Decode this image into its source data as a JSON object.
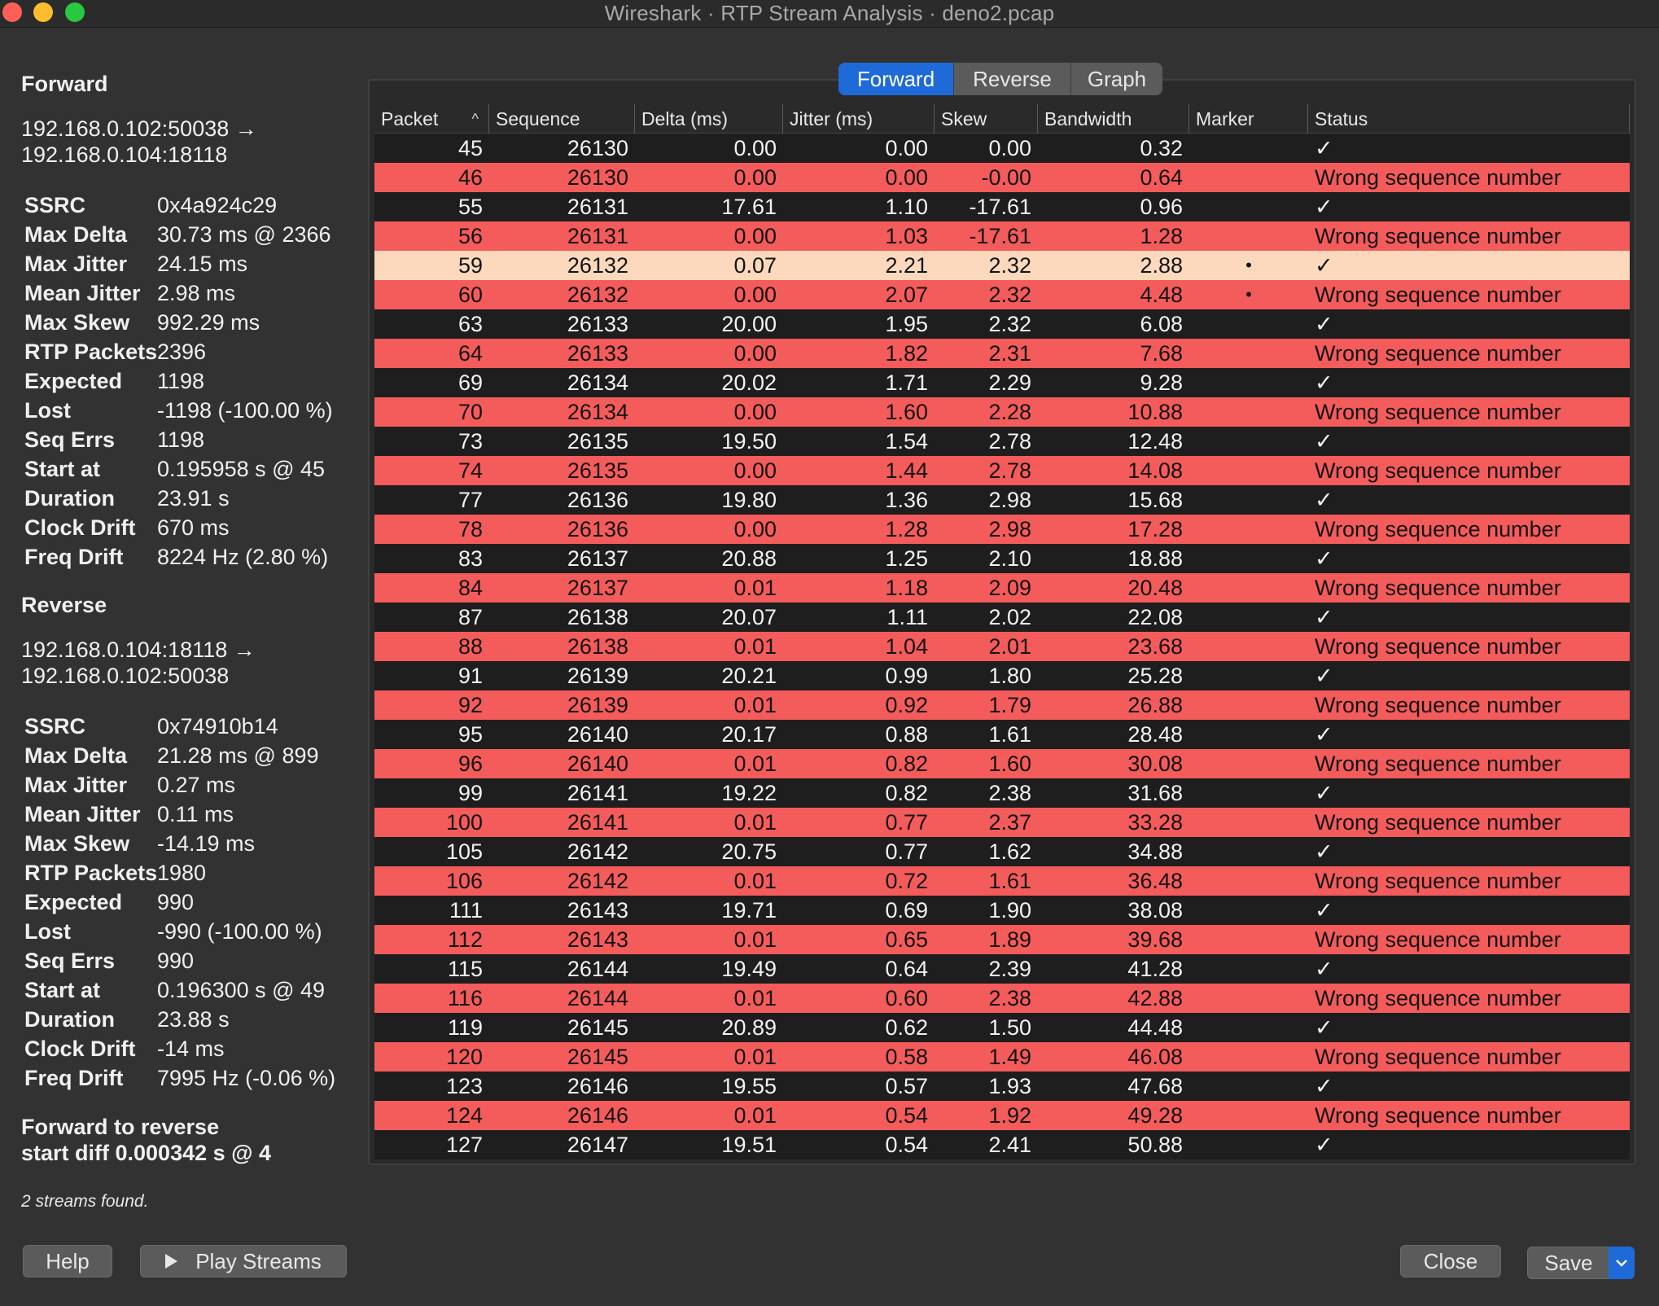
{
  "window": {
    "title": "Wireshark · RTP Stream Analysis · deno2.pcap"
  },
  "forward": {
    "title": "Forward",
    "address_line1": "192.168.0.102:50038 →",
    "address_line2": "192.168.0.104:18118",
    "stats": [
      {
        "key": "SSRC",
        "value": "0x4a924c29"
      },
      {
        "key": "Max Delta",
        "value": "30.73 ms @ 2366"
      },
      {
        "key": "Max Jitter",
        "value": "24.15 ms"
      },
      {
        "key": "Mean Jitter",
        "value": "2.98 ms"
      },
      {
        "key": "Max Skew",
        "value": "992.29 ms"
      },
      {
        "key": "RTP Packets",
        "value": "2396"
      },
      {
        "key": "Expected",
        "value": "1198"
      },
      {
        "key": "Lost",
        "value": "-1198 (-100.00 %)"
      },
      {
        "key": "Seq Errs",
        "value": "1198"
      },
      {
        "key": "Start at",
        "value": "0.195958 s @ 45"
      },
      {
        "key": "Duration",
        "value": "23.91 s"
      },
      {
        "key": "Clock Drift",
        "value": "670 ms"
      },
      {
        "key": "Freq Drift",
        "value": "8224 Hz (2.80 %)"
      }
    ]
  },
  "reverse": {
    "title": "Reverse",
    "address_line1": "192.168.0.104:18118 →",
    "address_line2": "192.168.0.102:50038",
    "stats": [
      {
        "key": "SSRC",
        "value": "0x74910b14"
      },
      {
        "key": "Max Delta",
        "value": "21.28 ms @ 899"
      },
      {
        "key": "Max Jitter",
        "value": "0.27 ms"
      },
      {
        "key": "Mean Jitter",
        "value": "0.11 ms"
      },
      {
        "key": "Max Skew",
        "value": "-14.19 ms"
      },
      {
        "key": "RTP Packets",
        "value": "1980"
      },
      {
        "key": "Expected",
        "value": "990"
      },
      {
        "key": "Lost",
        "value": "-990 (-100.00 %)"
      },
      {
        "key": "Seq Errs",
        "value": "990"
      },
      {
        "key": "Start at",
        "value": "0.196300 s @ 49"
      },
      {
        "key": "Duration",
        "value": "23.88 s"
      },
      {
        "key": "Clock Drift",
        "value": "-14 ms"
      },
      {
        "key": "Freq Drift",
        "value": "7995 Hz (-0.06 %)"
      }
    ]
  },
  "summary": {
    "start_diff_line1": "Forward to reverse",
    "start_diff_line2": "start diff 0.000342 s @ 4",
    "streams_found": "2 streams found."
  },
  "tabs": [
    {
      "label": "Forward",
      "active": true
    },
    {
      "label": "Reverse",
      "active": false
    },
    {
      "label": "Graph",
      "active": false
    }
  ],
  "table": {
    "columns": [
      "Packet",
      "Sequence",
      "Delta (ms)",
      "Jitter (ms)",
      "Skew",
      "Bandwidth",
      "Marker",
      "Status"
    ],
    "sort_indicator": "^",
    "rows": [
      {
        "packet": "45",
        "sequence": "26130",
        "delta": "0.00",
        "jitter": "0.00",
        "skew": "0.00",
        "bandwidth": "0.32",
        "marker": "",
        "status": "✓",
        "state": "ok"
      },
      {
        "packet": "46",
        "sequence": "26130",
        "delta": "0.00",
        "jitter": "0.00",
        "skew": "-0.00",
        "bandwidth": "0.64",
        "marker": "",
        "status": "Wrong sequence number",
        "state": "err"
      },
      {
        "packet": "55",
        "sequence": "26131",
        "delta": "17.61",
        "jitter": "1.10",
        "skew": "-17.61",
        "bandwidth": "0.96",
        "marker": "",
        "status": "✓",
        "state": "ok"
      },
      {
        "packet": "56",
        "sequence": "26131",
        "delta": "0.00",
        "jitter": "1.03",
        "skew": "-17.61",
        "bandwidth": "1.28",
        "marker": "",
        "status": "Wrong sequence number",
        "state": "err"
      },
      {
        "packet": "59",
        "sequence": "26132",
        "delta": "0.07",
        "jitter": "2.21",
        "skew": "2.32",
        "bandwidth": "2.88",
        "marker": "•",
        "status": "✓",
        "state": "sel"
      },
      {
        "packet": "60",
        "sequence": "26132",
        "delta": "0.00",
        "jitter": "2.07",
        "skew": "2.32",
        "bandwidth": "4.48",
        "marker": "•",
        "status": "Wrong sequence number",
        "state": "err"
      },
      {
        "packet": "63",
        "sequence": "26133",
        "delta": "20.00",
        "jitter": "1.95",
        "skew": "2.32",
        "bandwidth": "6.08",
        "marker": "",
        "status": "✓",
        "state": "ok"
      },
      {
        "packet": "64",
        "sequence": "26133",
        "delta": "0.00",
        "jitter": "1.82",
        "skew": "2.31",
        "bandwidth": "7.68",
        "marker": "",
        "status": "Wrong sequence number",
        "state": "err"
      },
      {
        "packet": "69",
        "sequence": "26134",
        "delta": "20.02",
        "jitter": "1.71",
        "skew": "2.29",
        "bandwidth": "9.28",
        "marker": "",
        "status": "✓",
        "state": "ok"
      },
      {
        "packet": "70",
        "sequence": "26134",
        "delta": "0.00",
        "jitter": "1.60",
        "skew": "2.28",
        "bandwidth": "10.88",
        "marker": "",
        "status": "Wrong sequence number",
        "state": "err"
      },
      {
        "packet": "73",
        "sequence": "26135",
        "delta": "19.50",
        "jitter": "1.54",
        "skew": "2.78",
        "bandwidth": "12.48",
        "marker": "",
        "status": "✓",
        "state": "ok"
      },
      {
        "packet": "74",
        "sequence": "26135",
        "delta": "0.00",
        "jitter": "1.44",
        "skew": "2.78",
        "bandwidth": "14.08",
        "marker": "",
        "status": "Wrong sequence number",
        "state": "err"
      },
      {
        "packet": "77",
        "sequence": "26136",
        "delta": "19.80",
        "jitter": "1.36",
        "skew": "2.98",
        "bandwidth": "15.68",
        "marker": "",
        "status": "✓",
        "state": "ok"
      },
      {
        "packet": "78",
        "sequence": "26136",
        "delta": "0.00",
        "jitter": "1.28",
        "skew": "2.98",
        "bandwidth": "17.28",
        "marker": "",
        "status": "Wrong sequence number",
        "state": "err"
      },
      {
        "packet": "83",
        "sequence": "26137",
        "delta": "20.88",
        "jitter": "1.25",
        "skew": "2.10",
        "bandwidth": "18.88",
        "marker": "",
        "status": "✓",
        "state": "ok"
      },
      {
        "packet": "84",
        "sequence": "26137",
        "delta": "0.01",
        "jitter": "1.18",
        "skew": "2.09",
        "bandwidth": "20.48",
        "marker": "",
        "status": "Wrong sequence number",
        "state": "err"
      },
      {
        "packet": "87",
        "sequence": "26138",
        "delta": "20.07",
        "jitter": "1.11",
        "skew": "2.02",
        "bandwidth": "22.08",
        "marker": "",
        "status": "✓",
        "state": "ok"
      },
      {
        "packet": "88",
        "sequence": "26138",
        "delta": "0.01",
        "jitter": "1.04",
        "skew": "2.01",
        "bandwidth": "23.68",
        "marker": "",
        "status": "Wrong sequence number",
        "state": "err"
      },
      {
        "packet": "91",
        "sequence": "26139",
        "delta": "20.21",
        "jitter": "0.99",
        "skew": "1.80",
        "bandwidth": "25.28",
        "marker": "",
        "status": "✓",
        "state": "ok"
      },
      {
        "packet": "92",
        "sequence": "26139",
        "delta": "0.01",
        "jitter": "0.92",
        "skew": "1.79",
        "bandwidth": "26.88",
        "marker": "",
        "status": "Wrong sequence number",
        "state": "err"
      },
      {
        "packet": "95",
        "sequence": "26140",
        "delta": "20.17",
        "jitter": "0.88",
        "skew": "1.61",
        "bandwidth": "28.48",
        "marker": "",
        "status": "✓",
        "state": "ok"
      },
      {
        "packet": "96",
        "sequence": "26140",
        "delta": "0.01",
        "jitter": "0.82",
        "skew": "1.60",
        "bandwidth": "30.08",
        "marker": "",
        "status": "Wrong sequence number",
        "state": "err"
      },
      {
        "packet": "99",
        "sequence": "26141",
        "delta": "19.22",
        "jitter": "0.82",
        "skew": "2.38",
        "bandwidth": "31.68",
        "marker": "",
        "status": "✓",
        "state": "ok"
      },
      {
        "packet": "100",
        "sequence": "26141",
        "delta": "0.01",
        "jitter": "0.77",
        "skew": "2.37",
        "bandwidth": "33.28",
        "marker": "",
        "status": "Wrong sequence number",
        "state": "err"
      },
      {
        "packet": "105",
        "sequence": "26142",
        "delta": "20.75",
        "jitter": "0.77",
        "skew": "1.62",
        "bandwidth": "34.88",
        "marker": "",
        "status": "✓",
        "state": "ok"
      },
      {
        "packet": "106",
        "sequence": "26142",
        "delta": "0.01",
        "jitter": "0.72",
        "skew": "1.61",
        "bandwidth": "36.48",
        "marker": "",
        "status": "Wrong sequence number",
        "state": "err"
      },
      {
        "packet": "111",
        "sequence": "26143",
        "delta": "19.71",
        "jitter": "0.69",
        "skew": "1.90",
        "bandwidth": "38.08",
        "marker": "",
        "status": "✓",
        "state": "ok"
      },
      {
        "packet": "112",
        "sequence": "26143",
        "delta": "0.01",
        "jitter": "0.65",
        "skew": "1.89",
        "bandwidth": "39.68",
        "marker": "",
        "status": "Wrong sequence number",
        "state": "err"
      },
      {
        "packet": "115",
        "sequence": "26144",
        "delta": "19.49",
        "jitter": "0.64",
        "skew": "2.39",
        "bandwidth": "41.28",
        "marker": "",
        "status": "✓",
        "state": "ok"
      },
      {
        "packet": "116",
        "sequence": "26144",
        "delta": "0.01",
        "jitter": "0.60",
        "skew": "2.38",
        "bandwidth": "42.88",
        "marker": "",
        "status": "Wrong sequence number",
        "state": "err"
      },
      {
        "packet": "119",
        "sequence": "26145",
        "delta": "20.89",
        "jitter": "0.62",
        "skew": "1.50",
        "bandwidth": "44.48",
        "marker": "",
        "status": "✓",
        "state": "ok"
      },
      {
        "packet": "120",
        "sequence": "26145",
        "delta": "0.01",
        "jitter": "0.58",
        "skew": "1.49",
        "bandwidth": "46.08",
        "marker": "",
        "status": "Wrong sequence number",
        "state": "err"
      },
      {
        "packet": "123",
        "sequence": "26146",
        "delta": "19.55",
        "jitter": "0.57",
        "skew": "1.93",
        "bandwidth": "47.68",
        "marker": "",
        "status": "✓",
        "state": "ok"
      },
      {
        "packet": "124",
        "sequence": "26146",
        "delta": "0.01",
        "jitter": "0.54",
        "skew": "1.92",
        "bandwidth": "49.28",
        "marker": "",
        "status": "Wrong sequence number",
        "state": "err"
      },
      {
        "packet": "127",
        "sequence": "26147",
        "delta": "19.51",
        "jitter": "0.54",
        "skew": "2.41",
        "bandwidth": "50.88",
        "marker": "",
        "status": "✓",
        "state": "ok"
      }
    ]
  },
  "buttons": {
    "help": "Help",
    "play_streams": "Play Streams",
    "close": "Close",
    "save": "Save"
  },
  "colors": {
    "error_row": "#f45b5b",
    "selected_row": "#fcd9bd",
    "accent": "#1f6ad9"
  },
  "icons": {
    "play": "play-icon",
    "dropdown": "chevron-down-icon",
    "sort": "sort-ascending-icon"
  }
}
